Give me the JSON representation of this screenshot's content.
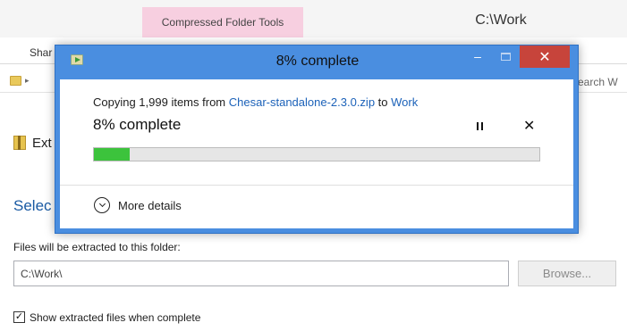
{
  "explorer": {
    "context_tab": "Compressed Folder Tools",
    "window_path": "C:\\Work",
    "ribbon_tab_share": "Shar",
    "search_text": "earch W",
    "extract_header": "Ext",
    "select_heading": "Selec",
    "dest_label": "Files will be extracted to this folder:",
    "dest_value": "C:\\Work\\",
    "browse_label": "Browse...",
    "show_files_label": "Show extracted files when complete",
    "show_files_checked": true,
    "check_glyph": "✓"
  },
  "dialog": {
    "title": "8% complete",
    "minimize_glyph": "–",
    "close_glyph": "✕",
    "copying_prefix": "Copying 1,999 items from ",
    "source_name": "Chesar-standalone-2.3.0.zip",
    "copying_to": " to ",
    "dest_name": "Work",
    "percent_text": "8% complete",
    "progress_fraction": 0.08,
    "cancel_glyph": "✕",
    "more_details_label": "More details"
  },
  "colors": {
    "accent": "#4a8ee0",
    "close_button": "#c7443b",
    "progress": "#3cc33c",
    "link": "#1c62b9",
    "context_tab": "#f7cfe0"
  },
  "icons": {
    "dialog_icon": "copy-progress-icon",
    "pause": "pause-icon",
    "cancel": "cancel-icon",
    "more_details": "chevron-down-circle-icon",
    "folder": "folder-icon",
    "extract": "zip-archive-icon"
  }
}
